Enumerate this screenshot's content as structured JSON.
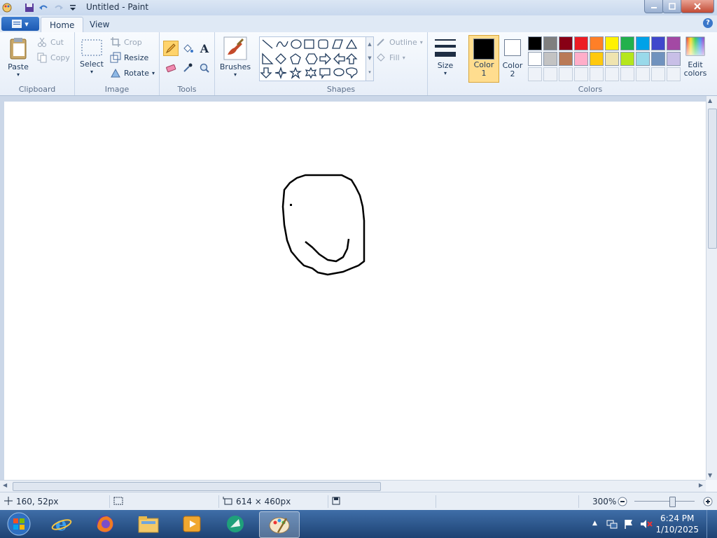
{
  "window": {
    "title": "Untitled - Paint"
  },
  "tabs": [
    {
      "label": "Home"
    },
    {
      "label": "View"
    }
  ],
  "ribbon": {
    "clipboard": {
      "group_label": "Clipboard",
      "paste": "Paste",
      "cut": "Cut",
      "copy": "Copy"
    },
    "image": {
      "group_label": "Image",
      "select": "Select",
      "crop": "Crop",
      "resize": "Resize",
      "rotate": "Rotate"
    },
    "tools": {
      "group_label": "Tools",
      "text_glyph": "A"
    },
    "brushes": {
      "label": "Brushes"
    },
    "shapes": {
      "group_label": "Shapes",
      "outline": "Outline",
      "fill": "Fill"
    },
    "size": {
      "label": "Size"
    },
    "colors": {
      "group_label": "Colors",
      "color1_label": "Color 1",
      "color2_label": "Color 2",
      "color1": "#000000",
      "color2": "#ffffff",
      "edit_colors": "Edit colors",
      "palette_row1": [
        "#000000",
        "#7f7f7f",
        "#880015",
        "#ed1c24",
        "#ff7f27",
        "#fff200",
        "#22b14c",
        "#00a2e8",
        "#3f48cc",
        "#a349a4"
      ],
      "palette_row2": [
        "#ffffff",
        "#c3c3c3",
        "#b97a57",
        "#ffaec9",
        "#ffc90e",
        "#efe4b0",
        "#b5e61d",
        "#99d9ea",
        "#7092be",
        "#c8bfe7"
      ]
    }
  },
  "status": {
    "cursor_pos": "160, 52px",
    "canvas_size": "614 × 460px",
    "zoom": "300%"
  },
  "taskbar": {
    "time": "6:24 PM",
    "date": "1/10/2025"
  }
}
